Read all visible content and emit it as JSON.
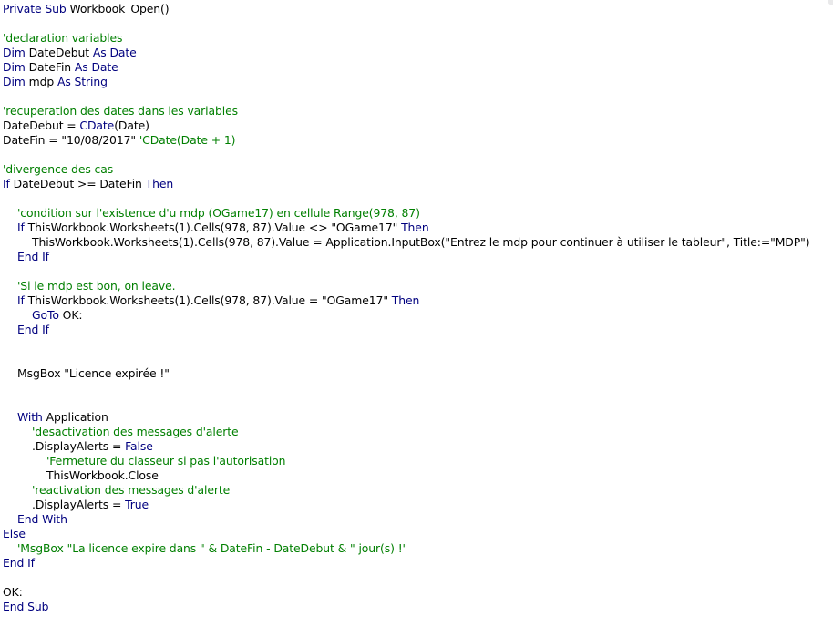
{
  "code_lines": [
    {
      "indent": 0,
      "tokens": [
        {
          "k": "kw",
          "t": "Private Sub"
        },
        {
          "k": "tx",
          "t": " Workbook_Open()"
        }
      ]
    },
    {
      "indent": 0,
      "tokens": []
    },
    {
      "indent": 0,
      "tokens": [
        {
          "k": "cm",
          "t": "'declaration variables"
        }
      ]
    },
    {
      "indent": 0,
      "tokens": [
        {
          "k": "kw",
          "t": "Dim"
        },
        {
          "k": "tx",
          "t": " DateDebut "
        },
        {
          "k": "kw",
          "t": "As Date"
        }
      ]
    },
    {
      "indent": 0,
      "tokens": [
        {
          "k": "kw",
          "t": "Dim"
        },
        {
          "k": "tx",
          "t": " DateFin "
        },
        {
          "k": "kw",
          "t": "As Date"
        }
      ]
    },
    {
      "indent": 0,
      "tokens": [
        {
          "k": "kw",
          "t": "Dim"
        },
        {
          "k": "tx",
          "t": " mdp "
        },
        {
          "k": "kw",
          "t": "As String"
        }
      ]
    },
    {
      "indent": 0,
      "tokens": []
    },
    {
      "indent": 0,
      "tokens": [
        {
          "k": "cm",
          "t": "'recuperation des dates dans les variables"
        }
      ]
    },
    {
      "indent": 0,
      "tokens": [
        {
          "k": "tx",
          "t": "DateDebut = "
        },
        {
          "k": "kw",
          "t": "CDate"
        },
        {
          "k": "tx",
          "t": "(Date)"
        }
      ]
    },
    {
      "indent": 0,
      "tokens": [
        {
          "k": "tx",
          "t": "DateFin = \"10/08/2017\" "
        },
        {
          "k": "cm",
          "t": "'CDate(Date + 1)"
        }
      ]
    },
    {
      "indent": 0,
      "tokens": []
    },
    {
      "indent": 0,
      "tokens": [
        {
          "k": "cm",
          "t": "'divergence des cas"
        }
      ]
    },
    {
      "indent": 0,
      "tokens": [
        {
          "k": "kw",
          "t": "If"
        },
        {
          "k": "tx",
          "t": " DateDebut >= DateFin "
        },
        {
          "k": "kw",
          "t": "Then"
        }
      ]
    },
    {
      "indent": 0,
      "tokens": []
    },
    {
      "indent": 1,
      "tokens": [
        {
          "k": "cm",
          "t": "'condition sur l'existence d'u mdp (OGame17) en cellule Range(978, 87)"
        }
      ]
    },
    {
      "indent": 1,
      "tokens": [
        {
          "k": "kw",
          "t": "If"
        },
        {
          "k": "tx",
          "t": " ThisWorkbook.Worksheets(1).Cells(978, 87).Value <> \"OGame17\" "
        },
        {
          "k": "kw",
          "t": "Then"
        }
      ]
    },
    {
      "indent": 2,
      "tokens": [
        {
          "k": "tx",
          "t": "ThisWorkbook.Worksheets(1).Cells(978, 87).Value = Application.InputBox(\"Entrez le mdp pour continuer à utiliser le tableur\", Title:=\"MDP\")"
        }
      ]
    },
    {
      "indent": 1,
      "tokens": [
        {
          "k": "kw",
          "t": "End If"
        }
      ]
    },
    {
      "indent": 0,
      "tokens": []
    },
    {
      "indent": 1,
      "tokens": [
        {
          "k": "cm",
          "t": "'Si le mdp est bon, on leave."
        }
      ]
    },
    {
      "indent": 1,
      "tokens": [
        {
          "k": "kw",
          "t": "If"
        },
        {
          "k": "tx",
          "t": " ThisWorkbook.Worksheets(1).Cells(978, 87).Value = \"OGame17\" "
        },
        {
          "k": "kw",
          "t": "Then"
        }
      ]
    },
    {
      "indent": 2,
      "tokens": [
        {
          "k": "kw",
          "t": "GoTo"
        },
        {
          "k": "tx",
          "t": " OK:"
        }
      ]
    },
    {
      "indent": 1,
      "tokens": [
        {
          "k": "kw",
          "t": "End If"
        }
      ]
    },
    {
      "indent": 0,
      "tokens": []
    },
    {
      "indent": 0,
      "tokens": []
    },
    {
      "indent": 1,
      "tokens": [
        {
          "k": "tx",
          "t": "MsgBox \"Licence expirée !\""
        }
      ]
    },
    {
      "indent": 0,
      "tokens": []
    },
    {
      "indent": 0,
      "tokens": []
    },
    {
      "indent": 1,
      "tokens": [
        {
          "k": "kw",
          "t": "With"
        },
        {
          "k": "tx",
          "t": " Application"
        }
      ]
    },
    {
      "indent": 2,
      "tokens": [
        {
          "k": "cm",
          "t": "'desactivation des messages d'alerte"
        }
      ]
    },
    {
      "indent": 2,
      "tokens": [
        {
          "k": "tx",
          "t": ".DisplayAlerts = "
        },
        {
          "k": "kw",
          "t": "False"
        }
      ]
    },
    {
      "indent": 3,
      "tokens": [
        {
          "k": "cm",
          "t": "'Fermeture du classeur si pas l'autorisation"
        }
      ]
    },
    {
      "indent": 3,
      "tokens": [
        {
          "k": "tx",
          "t": "ThisWorkbook.Close"
        }
      ]
    },
    {
      "indent": 2,
      "tokens": [
        {
          "k": "cm",
          "t": "'reactivation des messages d'alerte"
        }
      ]
    },
    {
      "indent": 2,
      "tokens": [
        {
          "k": "tx",
          "t": ".DisplayAlerts = "
        },
        {
          "k": "kw",
          "t": "True"
        }
      ]
    },
    {
      "indent": 1,
      "tokens": [
        {
          "k": "kw",
          "t": "End With"
        }
      ]
    },
    {
      "indent": 0,
      "tokens": [
        {
          "k": "kw",
          "t": "Else"
        }
      ]
    },
    {
      "indent": 1,
      "tokens": [
        {
          "k": "cm",
          "t": "'MsgBox \"La licence expire dans \" & DateFin - DateDebut & \" jour(s) !\""
        }
      ]
    },
    {
      "indent": 0,
      "tokens": [
        {
          "k": "kw",
          "t": "End If"
        }
      ]
    },
    {
      "indent": 0,
      "tokens": []
    },
    {
      "indent": 0,
      "tokens": [
        {
          "k": "tx",
          "t": "OK:"
        }
      ]
    },
    {
      "indent": 0,
      "tokens": [
        {
          "k": "kw",
          "t": "End Sub"
        }
      ]
    }
  ],
  "colors": {
    "keyword": "#00007f",
    "comment": "#007f00",
    "text": "#000000",
    "background": "#ffffff"
  }
}
